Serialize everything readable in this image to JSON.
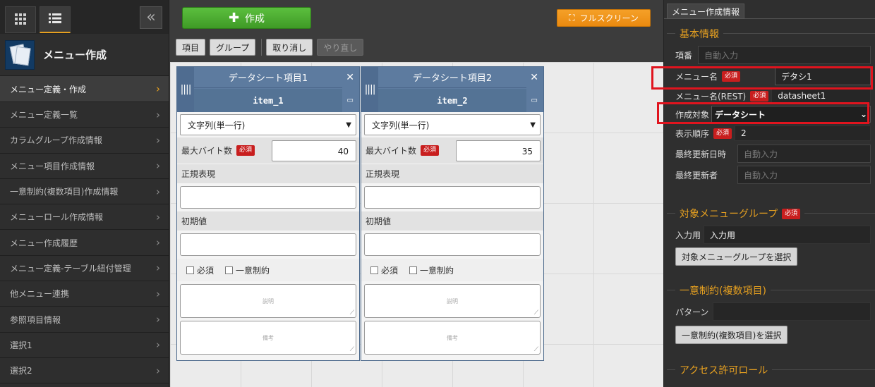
{
  "sidebar": {
    "title": "メニュー作成",
    "items": [
      {
        "label": "メニュー定義・作成",
        "active": true
      },
      {
        "label": "メニュー定義一覧"
      },
      {
        "label": "カラムグループ作成情報"
      },
      {
        "label": "メニュー項目作成情報"
      },
      {
        "label": "一意制約(複数項目)作成情報"
      },
      {
        "label": "メニューロール作成情報"
      },
      {
        "label": "メニュー作成履歴"
      },
      {
        "label": "メニュー定義-テーブル紐付管理"
      },
      {
        "label": "他メニュー連携"
      },
      {
        "label": "参照項目情報"
      },
      {
        "label": "選択1"
      },
      {
        "label": "選択2"
      }
    ]
  },
  "toolbar": {
    "create_label": "作成",
    "fullscreen_label": "フルスクリーン",
    "item_label": "項目",
    "group_label": "グループ",
    "undo_label": "取り消し",
    "redo_label": "やり直し"
  },
  "cards": [
    {
      "title": "データシート項目1",
      "code": "item_1",
      "type": "文字列(単一行)",
      "bytes_label": "最大バイト数",
      "bytes_value": "40",
      "regex_label": "正規表現",
      "default_label": "初期値",
      "required_label": "必須",
      "unique_label": "一意制約",
      "desc_placeholder": "説明",
      "note_placeholder": "備考",
      "req_badge": "必須"
    },
    {
      "title": "データシート項目2",
      "code": "item_2",
      "type": "文字列(単一行)",
      "bytes_label": "最大バイト数",
      "bytes_value": "35",
      "regex_label": "正規表現",
      "default_label": "初期値",
      "required_label": "必須",
      "unique_label": "一意制約",
      "desc_placeholder": "説明",
      "note_placeholder": "備考",
      "req_badge": "必須"
    }
  ],
  "right": {
    "tab": "メニュー作成情報",
    "basic_title": "基本情報",
    "item_no_label": "項番",
    "item_no_placeholder": "自動入力",
    "menu_name_label": "メニュー名",
    "menu_name_value": "デタシ1",
    "menu_rest_label": "メニュー名(REST)",
    "menu_rest_value": "datasheet1",
    "target_label": "作成対象",
    "target_value": "データシート",
    "order_label": "表示順序",
    "order_value": "2",
    "updated_label": "最終更新日時",
    "updated_placeholder": "自動入力",
    "updater_label": "最終更新者",
    "updater_placeholder": "自動入力",
    "required_badge": "必須",
    "group_title": "対象メニューグループ",
    "input_label": "入力用",
    "input_value": "入力用",
    "group_btn": "対象メニューグループを選択",
    "unique_title": "一意制約(複数項目)",
    "pattern_label": "パターン",
    "unique_btn": "一意制約(複数項目)を選択",
    "access_title": "アクセス許可ロール"
  },
  "colors": {
    "accent": "#e6a020",
    "create": "#4caf31",
    "fullscreen": "#f0941a",
    "required": "#c81e1e",
    "highlight": "#e0141e",
    "card_header": "#5d7b9f"
  }
}
